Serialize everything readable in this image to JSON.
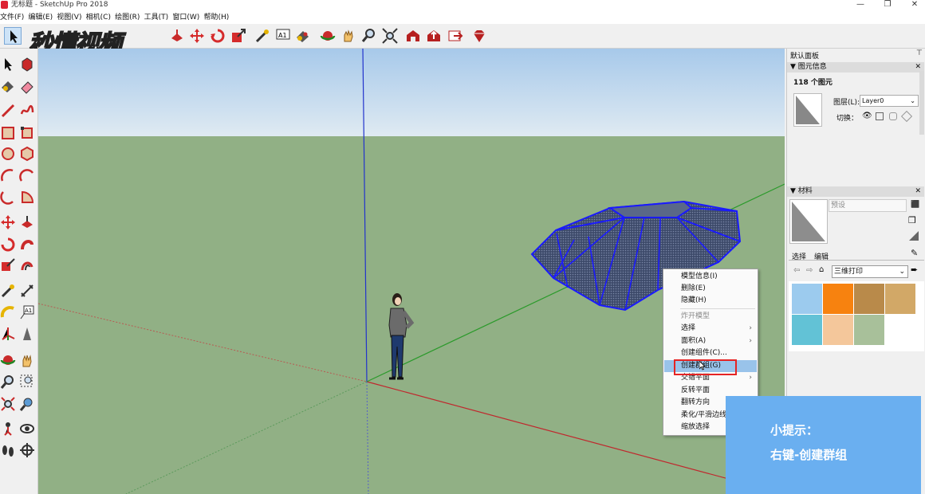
{
  "window": {
    "title": "无标题 - SketchUp Pro 2018",
    "controls": [
      "minimize-icon",
      "restore-icon",
      "close-icon"
    ]
  },
  "menu": [
    "文件(F)",
    "编辑(E)",
    "视图(V)",
    "相机(C)",
    "绘图(R)",
    "工具(T)",
    "窗口(W)",
    "帮助(H)"
  ],
  "watermark": "秒懂视频",
  "context_menu": {
    "items": [
      {
        "label": "模型信息(I)",
        "disabled": false,
        "submenu": false
      },
      {
        "label": "删除(E)",
        "disabled": false,
        "submenu": false
      },
      {
        "label": "隐藏(H)",
        "disabled": false,
        "submenu": false
      },
      {
        "label": "炸开模型",
        "disabled": true,
        "submenu": false
      },
      {
        "label": "选择",
        "disabled": false,
        "submenu": true
      },
      {
        "label": "面积(A)",
        "disabled": false,
        "submenu": true
      },
      {
        "label": "创建组件(C)...",
        "disabled": false,
        "submenu": false
      },
      {
        "label": "创建群组(G)",
        "disabled": false,
        "submenu": false,
        "highlighted": true
      },
      {
        "label": "交错平面",
        "disabled": false,
        "submenu": true
      },
      {
        "label": "反转平面",
        "disabled": false,
        "submenu": false
      },
      {
        "label": "翻转方向",
        "disabled": false,
        "submenu": false
      },
      {
        "label": "柔化/平滑边线",
        "disabled": false,
        "submenu": false
      },
      {
        "label": "缩放选择",
        "disabled": false,
        "submenu": false
      }
    ]
  },
  "tray": {
    "title": "默认面板",
    "entity_info": {
      "title": "图元信息",
      "count": "118 个图元",
      "layer_label": "图层(L):",
      "layer_value": "Layer0",
      "toggle_label": "切换："
    },
    "materials": {
      "title": "材料",
      "preset_placeholder": "预设",
      "tab_select": "选择",
      "tab_edit": "编辑",
      "library": "三维打印",
      "swatches": [
        "#9ccbee",
        "#f7820f",
        "#b98a4a",
        "#d2a867",
        "#62c2d6",
        "#f4c79b",
        "#a8c09a"
      ]
    }
  },
  "hint": {
    "line1": "小提示：",
    "line2": "右键-创建群组"
  },
  "colors": {
    "sky": "#bcd8f0",
    "ground": "#91b085",
    "selection": "#1a1aff",
    "hint_bg": "#6aaff0",
    "menu_highlight": "#99c3ea",
    "red_box": "#e52424"
  }
}
